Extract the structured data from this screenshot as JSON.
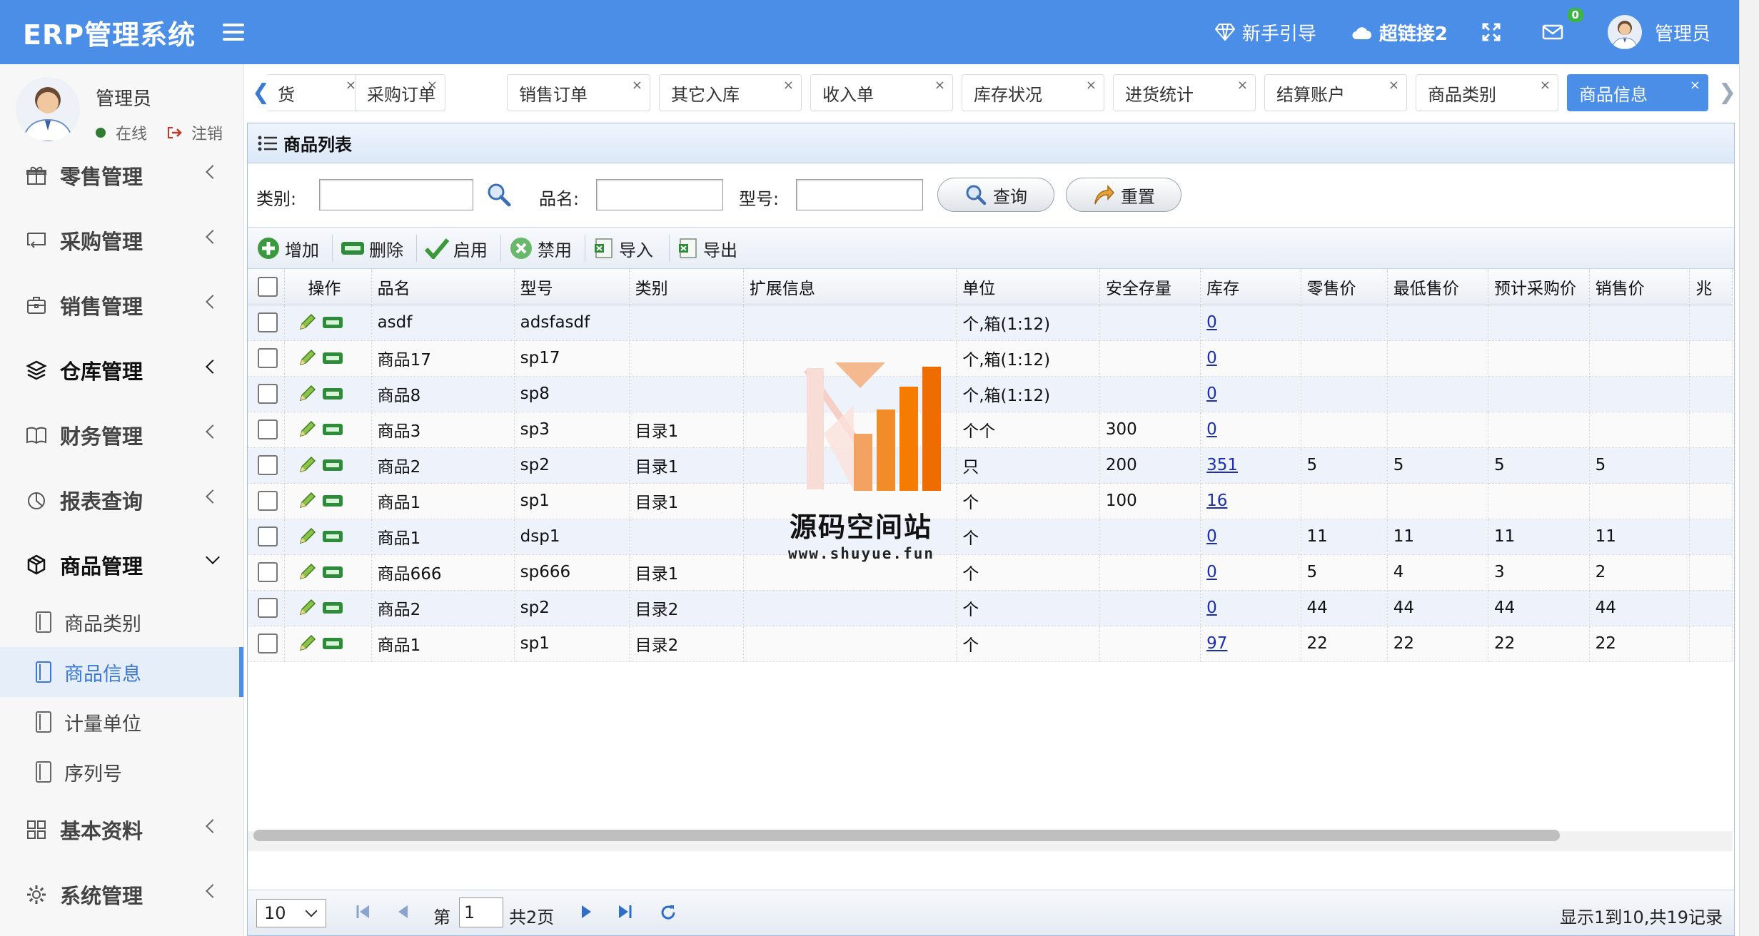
{
  "app": {
    "title": "ERP管理系统"
  },
  "header": {
    "guide": "新手引导",
    "link": "超链接2",
    "mail_badge": "0",
    "user": "管理员"
  },
  "sidebar": {
    "user": {
      "name": "管理员",
      "online": "在线",
      "logout": "注销"
    },
    "menu": [
      {
        "label": "零售管理",
        "icon": "gift-icon"
      },
      {
        "label": "采购管理",
        "icon": "purchase-icon"
      },
      {
        "label": "销售管理",
        "icon": "briefcase-icon"
      },
      {
        "label": "仓库管理",
        "icon": "layers-icon"
      },
      {
        "label": "财务管理",
        "icon": "book-icon"
      },
      {
        "label": "报表查询",
        "icon": "pie-chart-icon"
      },
      {
        "label": "商品管理",
        "icon": "cube-icon"
      },
      {
        "label": "基本资料",
        "icon": "grid-icon"
      },
      {
        "label": "系统管理",
        "icon": "gear-icon"
      }
    ],
    "submenu": [
      "商品类别",
      "商品信息",
      "计量单位",
      "序列号"
    ]
  },
  "tabs": [
    "货",
    "采购订单",
    "销售订单",
    "其它入库",
    "收入单",
    "库存状况",
    "进货统计",
    "结算账户",
    "商品类别",
    "商品信息"
  ],
  "panel": {
    "title": "商品列表"
  },
  "search": {
    "category": "类别:",
    "name": "品名:",
    "model": "型号:",
    "query": "查询",
    "reset": "重置"
  },
  "toolbar": {
    "add": "增加",
    "delete": "删除",
    "enable": "启用",
    "disable": "禁用",
    "import": "导入",
    "export": "导出"
  },
  "columns": [
    "操作",
    "品名",
    "型号",
    "类别",
    "扩展信息",
    "单位",
    "安全存量",
    "库存",
    "零售价",
    "最低售价",
    "预计采购价",
    "销售价",
    "兆"
  ],
  "rows": [
    {
      "name": "asdf",
      "model": "adsfasdf",
      "category": "",
      "ext": "",
      "unit": "个,箱(1:12)",
      "safety": "",
      "stock": "0",
      "retail": "",
      "min": "",
      "purchase": "",
      "sale": ""
    },
    {
      "name": "商品17",
      "model": "sp17",
      "category": "",
      "ext": "",
      "unit": "个,箱(1:12)",
      "safety": "",
      "stock": "0",
      "retail": "",
      "min": "",
      "purchase": "",
      "sale": ""
    },
    {
      "name": "商品8",
      "model": "sp8",
      "category": "",
      "ext": "",
      "unit": "个,箱(1:12)",
      "safety": "",
      "stock": "0",
      "retail": "",
      "min": "",
      "purchase": "",
      "sale": ""
    },
    {
      "name": "商品3",
      "model": "sp3",
      "category": "目录1",
      "ext": "",
      "unit": "个个",
      "safety": "300",
      "stock": "0",
      "retail": "",
      "min": "",
      "purchase": "",
      "sale": ""
    },
    {
      "name": "商品2",
      "model": "sp2",
      "category": "目录1",
      "ext": "",
      "unit": "只",
      "safety": "200",
      "stock": "351",
      "retail": "5",
      "min": "5",
      "purchase": "5",
      "sale": "5"
    },
    {
      "name": "商品1",
      "model": "sp1",
      "category": "目录1",
      "ext": "",
      "unit": "个",
      "safety": "100",
      "stock": "16",
      "retail": "",
      "min": "",
      "purchase": "",
      "sale": ""
    },
    {
      "name": "商品1",
      "model": "dsp1",
      "category": "",
      "ext": "",
      "unit": "个",
      "safety": "",
      "stock": "0",
      "retail": "11",
      "min": "11",
      "purchase": "11",
      "sale": "11"
    },
    {
      "name": "商品666",
      "model": "sp666",
      "category": "目录1",
      "ext": "",
      "unit": "个",
      "safety": "",
      "stock": "0",
      "retail": "5",
      "min": "4",
      "purchase": "3",
      "sale": "2"
    },
    {
      "name": "商品2",
      "model": "sp2",
      "category": "目录2",
      "ext": "",
      "unit": "个",
      "safety": "",
      "stock": "0",
      "retail": "44",
      "min": "44",
      "purchase": "44",
      "sale": "44"
    },
    {
      "name": "商品1",
      "model": "sp1",
      "category": "目录2",
      "ext": "",
      "unit": "个",
      "safety": "",
      "stock": "97",
      "retail": "22",
      "min": "22",
      "purchase": "22",
      "sale": "22"
    }
  ],
  "pager": {
    "page_size": "10",
    "page_prefix": "第",
    "page": "1",
    "page_total": "共2页",
    "summary": "显示1到10,共19记录"
  },
  "watermark": {
    "title": "源码空间站",
    "url": "www.shuyue.fun"
  },
  "colors": {
    "header": "#4a8ee8",
    "active_tab": "#4a8ee8",
    "link": "#1a2fb0"
  }
}
